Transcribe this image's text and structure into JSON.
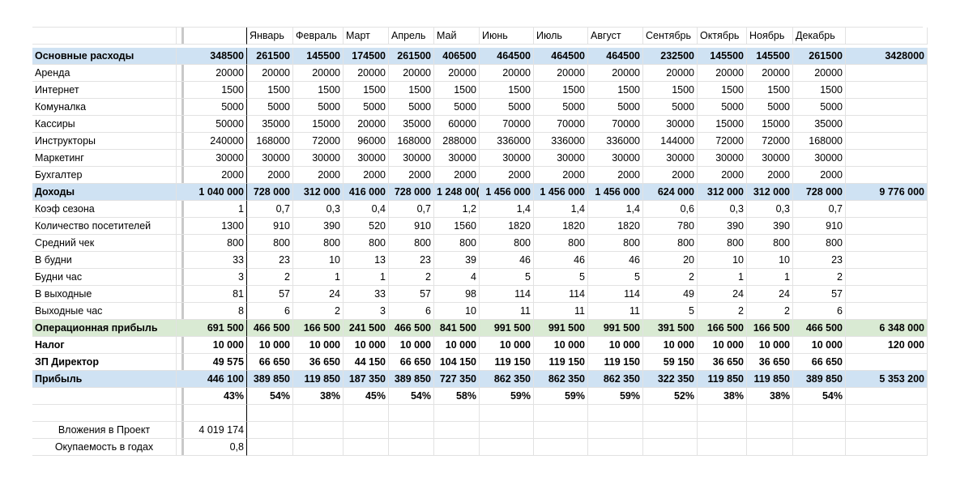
{
  "header": {
    "months": [
      "Январь",
      "Февраль",
      "Март",
      "Апрель",
      "Май",
      "Июнь",
      "Июль",
      "Август",
      "Сентябрь",
      "Октябрь",
      "Ноябрь",
      "Декабрь"
    ]
  },
  "rows": [
    {
      "label": "Основные расходы",
      "base": "348500",
      "months": [
        "261500",
        "145500",
        "174500",
        "261500",
        "406500",
        "464500",
        "464500",
        "464500",
        "232500",
        "145500",
        "145500",
        "261500"
      ],
      "total": "3428000"
    },
    {
      "label": "Аренда",
      "base": "20000",
      "months": [
        "20000",
        "20000",
        "20000",
        "20000",
        "20000",
        "20000",
        "20000",
        "20000",
        "20000",
        "20000",
        "20000",
        "20000"
      ],
      "total": ""
    },
    {
      "label": "Интернет",
      "base": "1500",
      "months": [
        "1500",
        "1500",
        "1500",
        "1500",
        "1500",
        "1500",
        "1500",
        "1500",
        "1500",
        "1500",
        "1500",
        "1500"
      ],
      "total": ""
    },
    {
      "label": "Комуналка",
      "base": "5000",
      "months": [
        "5000",
        "5000",
        "5000",
        "5000",
        "5000",
        "5000",
        "5000",
        "5000",
        "5000",
        "5000",
        "5000",
        "5000"
      ],
      "total": ""
    },
    {
      "label": "Кассиры",
      "base": "50000",
      "months": [
        "35000",
        "15000",
        "20000",
        "35000",
        "60000",
        "70000",
        "70000",
        "70000",
        "30000",
        "15000",
        "15000",
        "35000"
      ],
      "total": ""
    },
    {
      "label": "Инструкторы",
      "base": "240000",
      "months": [
        "168000",
        "72000",
        "96000",
        "168000",
        "288000",
        "336000",
        "336000",
        "336000",
        "144000",
        "72000",
        "72000",
        "168000"
      ],
      "total": ""
    },
    {
      "label": "Маркетинг",
      "base": "30000",
      "months": [
        "30000",
        "30000",
        "30000",
        "30000",
        "30000",
        "30000",
        "30000",
        "30000",
        "30000",
        "30000",
        "30000",
        "30000"
      ],
      "total": ""
    },
    {
      "label": "Бухгалтер",
      "base": "2000",
      "months": [
        "2000",
        "2000",
        "2000",
        "2000",
        "2000",
        "2000",
        "2000",
        "2000",
        "2000",
        "2000",
        "2000",
        "2000"
      ],
      "total": ""
    },
    {
      "label": "Доходы",
      "base": "1 040 000",
      "months": [
        "728 000",
        "312 000",
        "416 000",
        "728 000",
        "1 248 00(",
        "1 456 000",
        "1 456 000",
        "1 456 000",
        "624 000",
        "312 000",
        "312 000",
        "728 000"
      ],
      "total": "9 776 000"
    },
    {
      "label": "Коэф сезона",
      "base": "1",
      "months": [
        "0,7",
        "0,3",
        "0,4",
        "0,7",
        "1,2",
        "1,4",
        "1,4",
        "1,4",
        "0,6",
        "0,3",
        "0,3",
        "0,7"
      ],
      "total": ""
    },
    {
      "label": "Количество посетителей",
      "base": "1300",
      "months": [
        "910",
        "390",
        "520",
        "910",
        "1560",
        "1820",
        "1820",
        "1820",
        "780",
        "390",
        "390",
        "910"
      ],
      "total": ""
    },
    {
      "label": "Средний чек",
      "base": "800",
      "months": [
        "800",
        "800",
        "800",
        "800",
        "800",
        "800",
        "800",
        "800",
        "800",
        "800",
        "800",
        "800"
      ],
      "total": ""
    },
    {
      "label": "В будни",
      "base": "33",
      "months": [
        "23",
        "10",
        "13",
        "23",
        "39",
        "46",
        "46",
        "46",
        "20",
        "10",
        "10",
        "23"
      ],
      "total": ""
    },
    {
      "label": "Будни час",
      "base": "3",
      "months": [
        "2",
        "1",
        "1",
        "2",
        "4",
        "5",
        "5",
        "5",
        "2",
        "1",
        "1",
        "2"
      ],
      "total": ""
    },
    {
      "label": "В выходные",
      "base": "81",
      "months": [
        "57",
        "24",
        "33",
        "57",
        "98",
        "114",
        "114",
        "114",
        "49",
        "24",
        "24",
        "57"
      ],
      "total": ""
    },
    {
      "label": "Выходные час",
      "base": "8",
      "months": [
        "6",
        "2",
        "3",
        "6",
        "10",
        "11",
        "11",
        "11",
        "5",
        "2",
        "2",
        "6"
      ],
      "total": ""
    },
    {
      "label": "Операционная прибыль",
      "base": "691 500",
      "months": [
        "466 500",
        "166 500",
        "241 500",
        "466 500",
        "841 500",
        "991 500",
        "991 500",
        "991 500",
        "391 500",
        "166 500",
        "166 500",
        "466 500"
      ],
      "total": "6 348 000"
    },
    {
      "label": "Налог",
      "base": "10 000",
      "months": [
        "10 000",
        "10 000",
        "10 000",
        "10 000",
        "10 000",
        "10 000",
        "10 000",
        "10 000",
        "10 000",
        "10 000",
        "10 000",
        "10 000"
      ],
      "total": "120 000"
    },
    {
      "label": "ЗП Директор",
      "base": "49 575",
      "months": [
        "66 650",
        "36 650",
        "44 150",
        "66 650",
        "104 150",
        "119 150",
        "119 150",
        "119 150",
        "59 150",
        "36 650",
        "36 650",
        "66 650"
      ],
      "total": ""
    },
    {
      "label": "Прибыль",
      "base": "446 100",
      "months": [
        "389 850",
        "119 850",
        "187 350",
        "389 850",
        "727 350",
        "862 350",
        "862 350",
        "862 350",
        "322 350",
        "119 850",
        "119 850",
        "389 850"
      ],
      "total": "5 353 200"
    },
    {
      "label": "",
      "base": "43%",
      "months": [
        "54%",
        "38%",
        "45%",
        "54%",
        "58%",
        "59%",
        "59%",
        "59%",
        "52%",
        "38%",
        "38%",
        "54%"
      ],
      "total": ""
    },
    {
      "label": "",
      "base": "",
      "months": [
        "",
        "",
        "",
        "",
        "",
        "",
        "",
        "",
        "",
        "",
        "",
        ""
      ],
      "total": ""
    },
    {
      "label": "Вложения в Проект",
      "base": "4 019 174",
      "months": [
        "",
        "",
        "",
        "",
        "",
        "",
        "",
        "",
        "",
        "",
        "",
        ""
      ],
      "total": ""
    },
    {
      "label": "Окупаемость в годах",
      "base": "0,8",
      "months": [
        "",
        "",
        "",
        "",
        "",
        "",
        "",
        "",
        "",
        "",
        "",
        ""
      ],
      "total": ""
    }
  ]
}
